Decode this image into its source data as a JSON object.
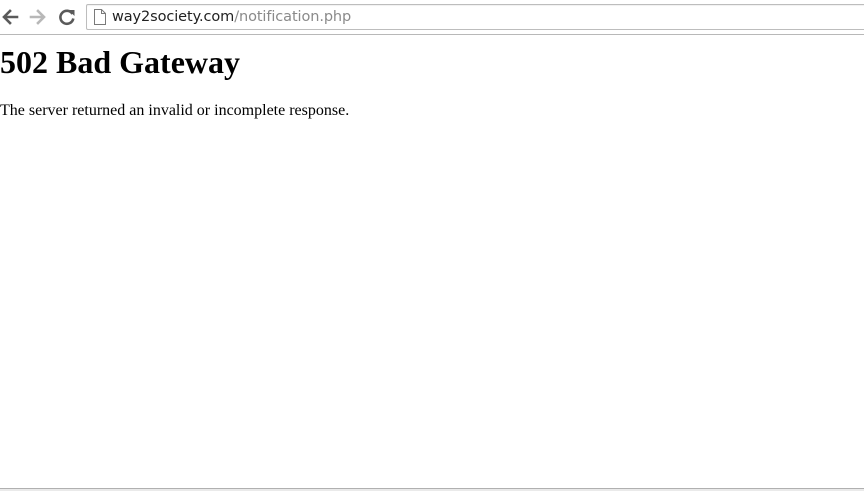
{
  "browser": {
    "url_host": "way2society.com",
    "url_path": "/notification.php",
    "icons": {
      "back": "arrow-left-icon",
      "forward": "arrow-right-icon",
      "reload": "reload-icon",
      "page": "page-document-icon"
    },
    "colors": {
      "icon_active": "#5a5a5a",
      "icon_disabled": "#b8b8b8",
      "url_host": "#222222",
      "url_path": "#8a8a8a"
    }
  },
  "page": {
    "title": "502 Bad Gateway",
    "message": "The server returned an invalid or incomplete response."
  }
}
